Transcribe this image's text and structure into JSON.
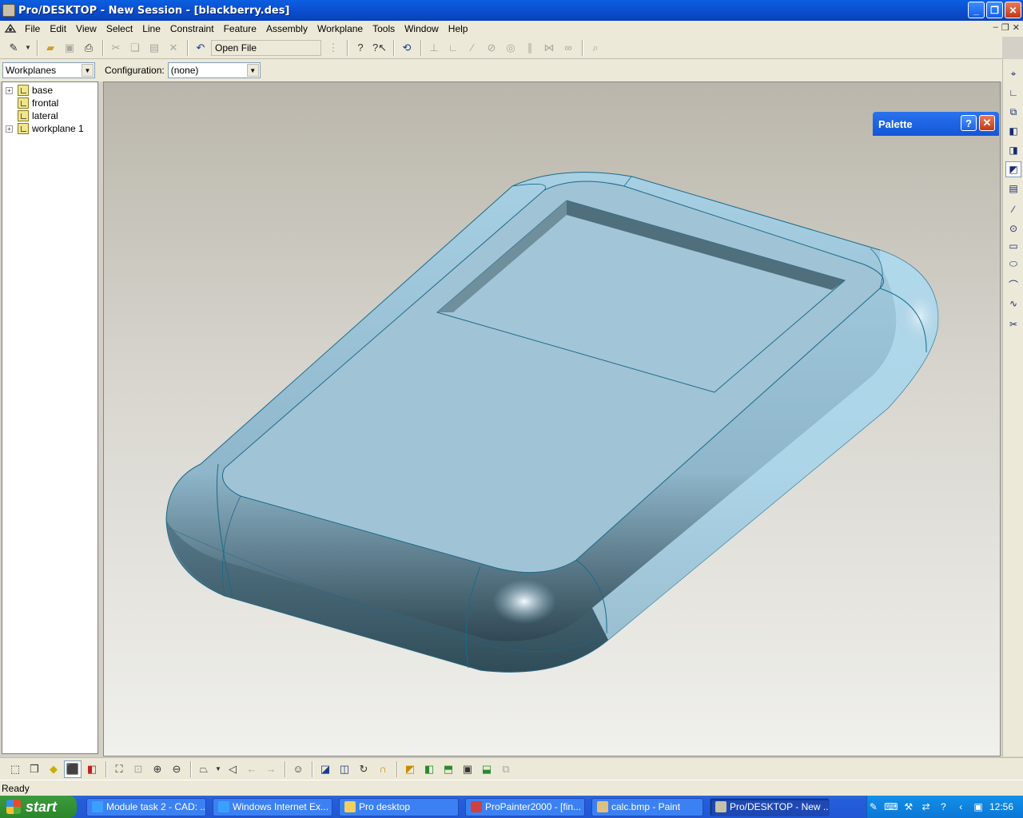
{
  "window": {
    "title": "Pro/DESKTOP - New Session - [blackberry.des]",
    "controls": {
      "minimize": "_",
      "maximize": "❐",
      "close": "✕"
    }
  },
  "menu": [
    "File",
    "Edit",
    "View",
    "Select",
    "Line",
    "Constraint",
    "Feature",
    "Assembly",
    "Workplane",
    "Tools",
    "Window",
    "Help"
  ],
  "toolbar": {
    "command_field": "Open File"
  },
  "workplanes_select": {
    "value": "Workplanes"
  },
  "configuration": {
    "label": "Configuration:",
    "value": "(none)"
  },
  "tree": {
    "items": [
      {
        "label": "base",
        "expandable": true
      },
      {
        "label": "frontal",
        "expandable": false
      },
      {
        "label": "lateral",
        "expandable": false
      },
      {
        "label": "workplane 1",
        "expandable": true
      }
    ]
  },
  "palette": {
    "title": "Palette",
    "help": "?",
    "close": "✕"
  },
  "statusbar": {
    "text": "Ready"
  },
  "taskbar": {
    "start": "start",
    "tasks": [
      {
        "label": "Module task 2 - CAD: ...",
        "active": false,
        "icon_color": "#3aa0ff"
      },
      {
        "label": "Windows Internet Ex...",
        "active": false,
        "icon_color": "#3aa0ff"
      },
      {
        "label": "Pro desktop",
        "active": false,
        "icon_color": "#f0d060"
      },
      {
        "label": "ProPainter2000 - [fin...",
        "active": false,
        "icon_color": "#d04040"
      },
      {
        "label": "calc.bmp - Paint",
        "active": false,
        "icon_color": "#e0c080"
      },
      {
        "label": "Pro/DESKTOP - New ...",
        "active": true,
        "icon_color": "#c8c0a8"
      }
    ],
    "clock": "12:56"
  },
  "colors": {
    "model_fill": "#9fc4d8",
    "model_highlight": "#e8f4fa",
    "model_shadow": "#2a4652",
    "edge_line": "#1a6a8a"
  }
}
